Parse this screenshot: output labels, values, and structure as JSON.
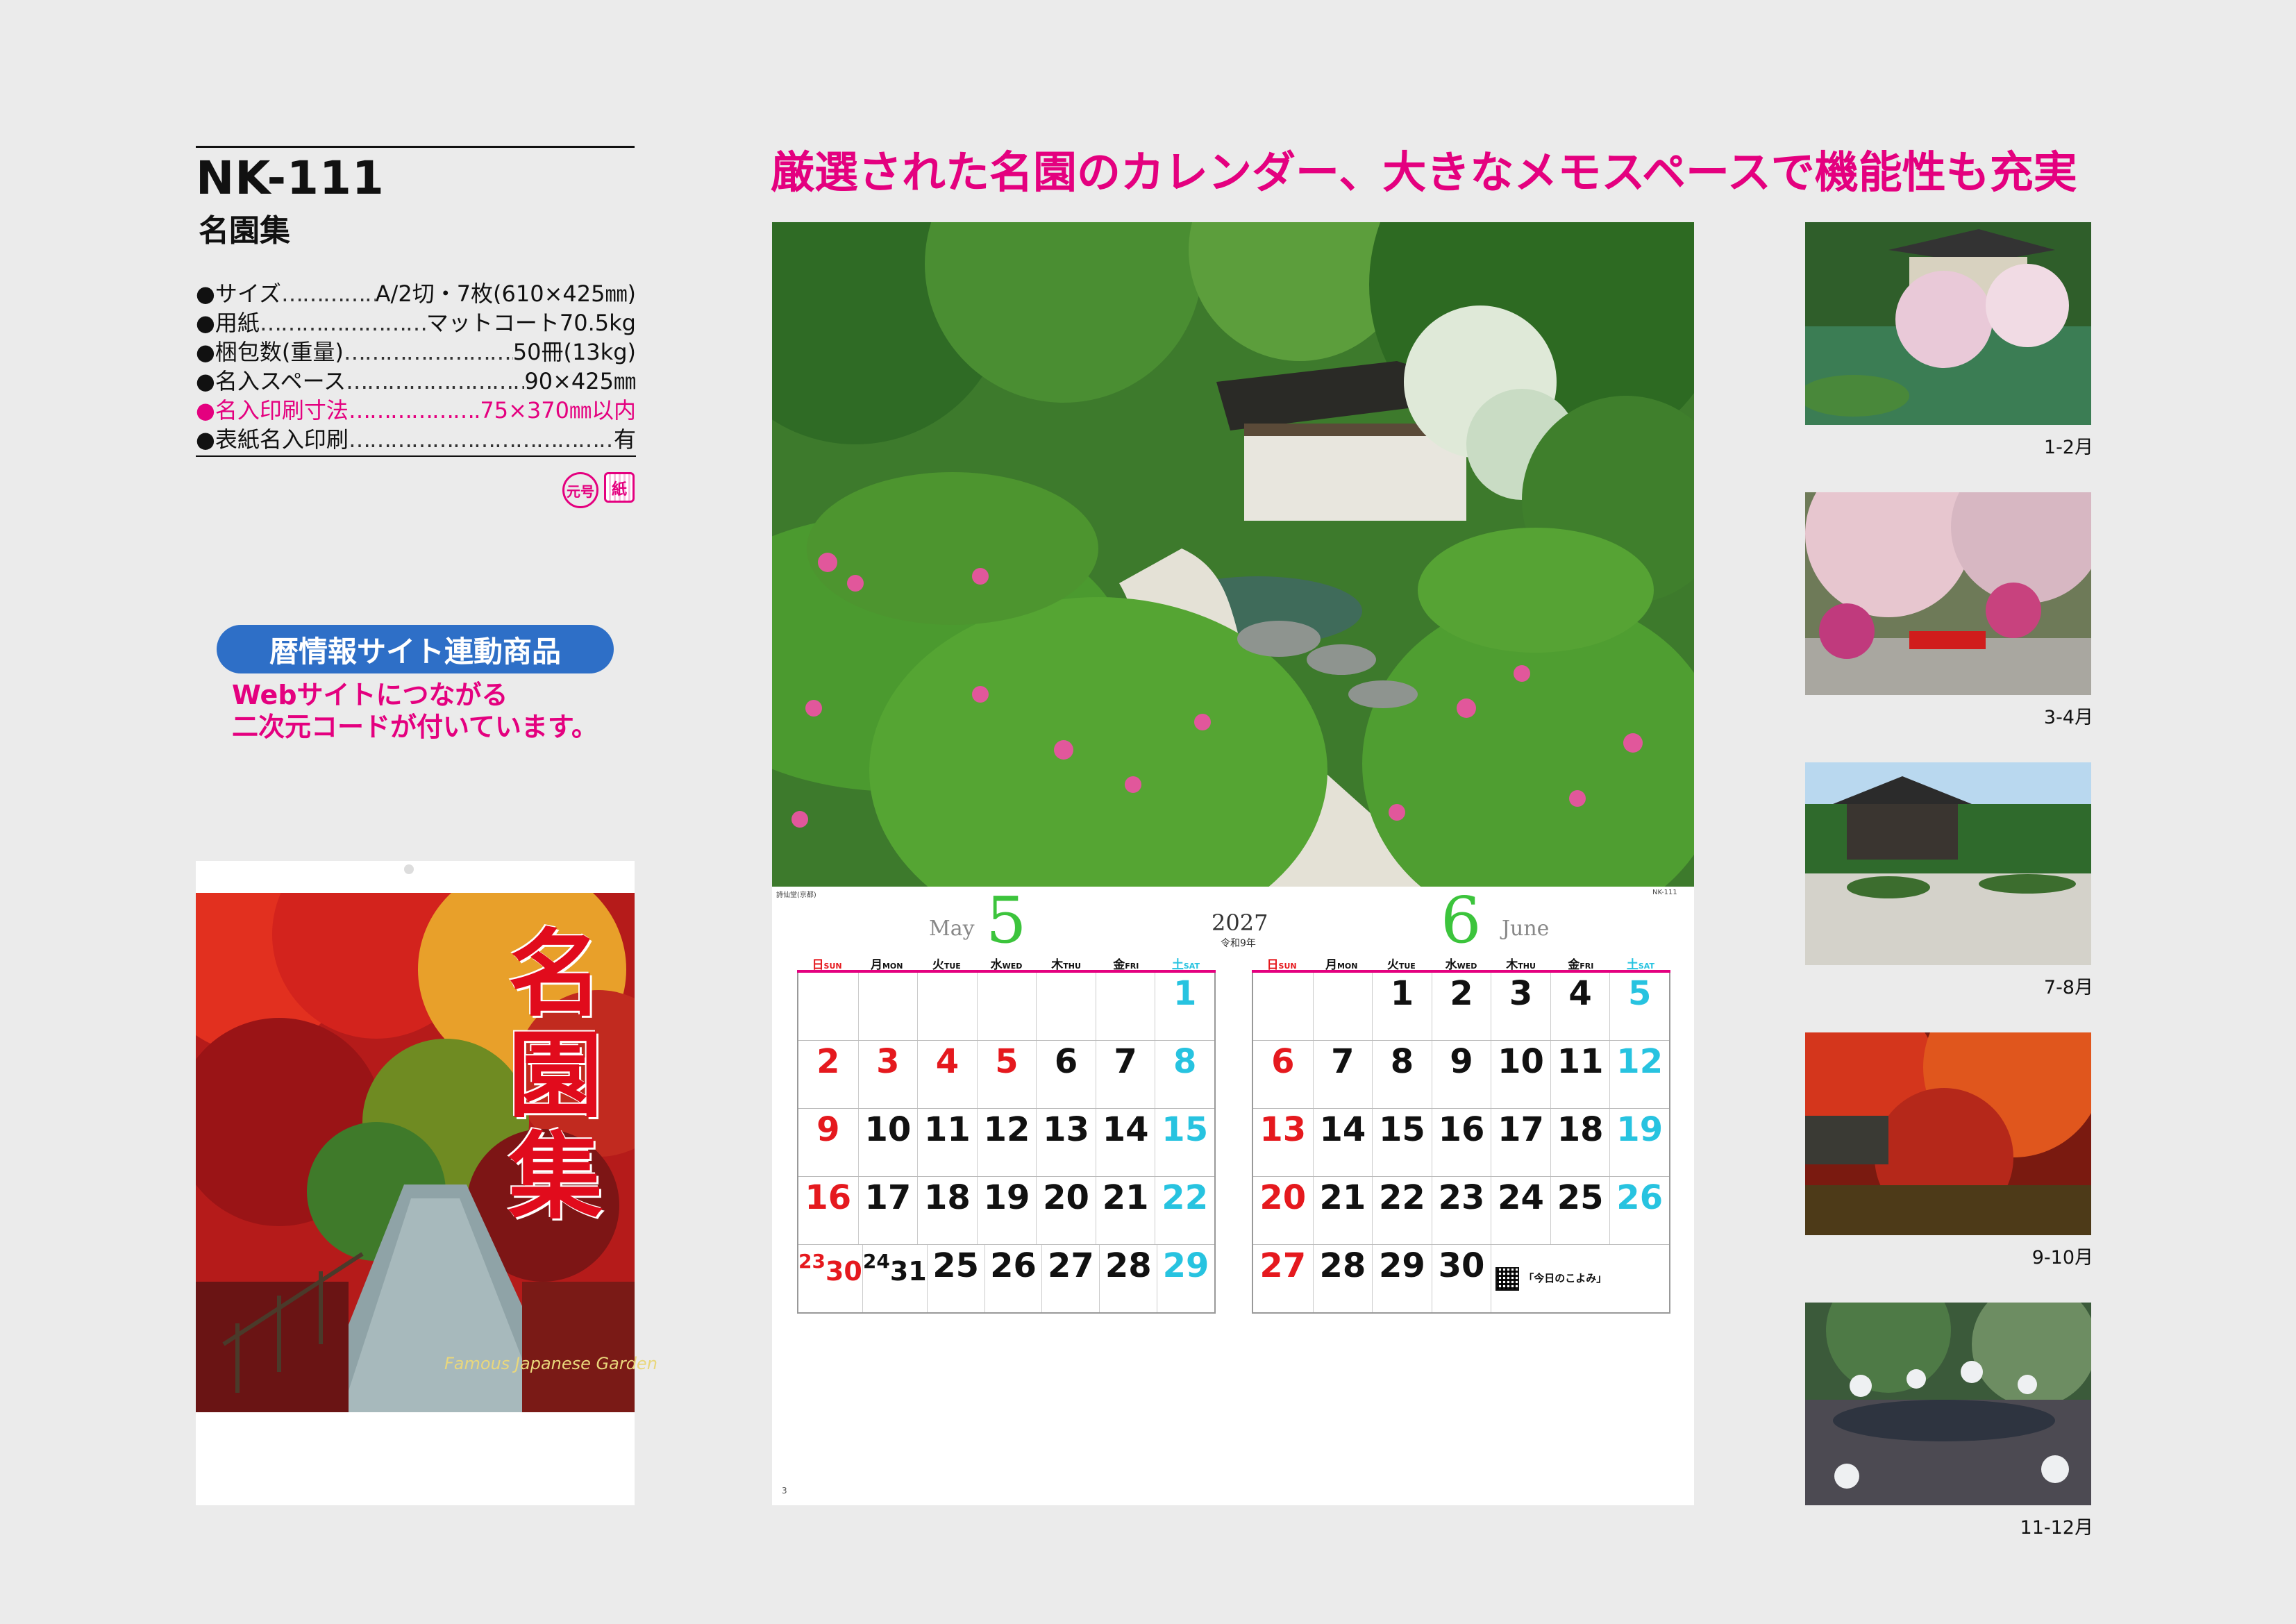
{
  "product": {
    "code": "NK-111",
    "name": "名園集"
  },
  "specs": [
    {
      "label": "●サイズ",
      "value": "A/2切・7枚(610×425㎜)"
    },
    {
      "label": "●用紙",
      "value": "マットコート70.5kg"
    },
    {
      "label": "●梱包数(重量)",
      "value": "50冊(13kg)"
    },
    {
      "label": "●名入スペース",
      "value": "90×425㎜"
    },
    {
      "label": "●名入印刷寸法",
      "value": "75×370㎜以内",
      "highlight": true
    },
    {
      "label": "●表紙名入印刷",
      "value": "有"
    }
  ],
  "badges": {
    "round": "元号",
    "square": "紙"
  },
  "promo": {
    "pill": "暦情報サイト連動商品",
    "line1": "Webサイトにつながる",
    "line2": "二次元コードが付いています。"
  },
  "cover": {
    "title": "名園集",
    "subtitle": "Famous Japanese Garden"
  },
  "headline": "厳選された名園のカレンダー、大きなメモスペースで機能性も充実",
  "calendar": {
    "photo_caption": "詩仙堂(京都)",
    "code": "NK-111",
    "page_number": "3",
    "year": "2027",
    "era": "令和9年",
    "weekdays": [
      {
        "jp": "日",
        "en": "SUN"
      },
      {
        "jp": "月",
        "en": "MON"
      },
      {
        "jp": "火",
        "en": "TUE"
      },
      {
        "jp": "水",
        "en": "WED"
      },
      {
        "jp": "木",
        "en": "THU"
      },
      {
        "jp": "金",
        "en": "FRI"
      },
      {
        "jp": "土",
        "en": "SAT"
      }
    ],
    "months": [
      {
        "num": "5",
        "en": "May",
        "weeks": [
          [
            "",
            "",
            "",
            "",
            "",
            "",
            "1"
          ],
          [
            "2",
            "3",
            "4",
            "5",
            "6",
            "7",
            "8"
          ],
          [
            "9",
            "10",
            "11",
            "12",
            "13",
            "14",
            "15"
          ],
          [
            "16",
            "17",
            "18",
            "19",
            "20",
            "21",
            "22"
          ],
          [
            "23/30",
            "24/31",
            "25",
            "26",
            "27",
            "28",
            "29"
          ]
        ],
        "holidays": [
          "3",
          "4",
          "5"
        ]
      },
      {
        "num": "6",
        "en": "June",
        "weeks": [
          [
            "",
            "",
            "1",
            "2",
            "3",
            "4",
            "5"
          ],
          [
            "6",
            "7",
            "8",
            "9",
            "10",
            "11",
            "12"
          ],
          [
            "13",
            "14",
            "15",
            "16",
            "17",
            "18",
            "19"
          ],
          [
            "20",
            "21",
            "22",
            "23",
            "24",
            "25",
            "26"
          ],
          [
            "27",
            "28",
            "29",
            "30",
            "",
            "",
            ""
          ]
        ],
        "holidays": [],
        "qr_title": "「今日のこよみ」"
      }
    ]
  },
  "thumbnails": [
    {
      "label": "1-2月"
    },
    {
      "label": "3-4月"
    },
    {
      "label": "7-8月"
    },
    {
      "label": "9-10月"
    },
    {
      "label": "11-12月"
    }
  ],
  "colors": {
    "accent": "#e4007f",
    "pill": "#2e6fc7",
    "sunday": "#e5191e",
    "saturday": "#27c3e0",
    "may_number": "#3cc43c",
    "june_number": "#3cc43c"
  }
}
